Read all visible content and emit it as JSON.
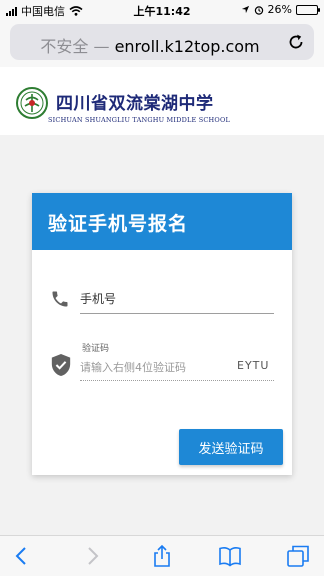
{
  "status_bar": {
    "carrier": "中国电信",
    "time": "上午11:42",
    "battery_percent": "26%",
    "battery_level": 0.26
  },
  "address_bar": {
    "security_label": "不安全",
    "separator": "—",
    "domain": "enroll.k12top.com"
  },
  "school": {
    "name_cn": "四川省双流棠湖中学",
    "name_en": "SICHUAN SHUANGLIU  TANGHU MIDDLE SCHOOL"
  },
  "form": {
    "title": "验证手机号报名",
    "phone_placeholder": "手机号",
    "code_label": "验证码",
    "code_placeholder": "请输入右侧4位验证码",
    "captcha": "EYTU",
    "send_button": "发送验证码"
  },
  "colors": {
    "accent": "#1e88d6",
    "school_text": "#1e2a78"
  }
}
